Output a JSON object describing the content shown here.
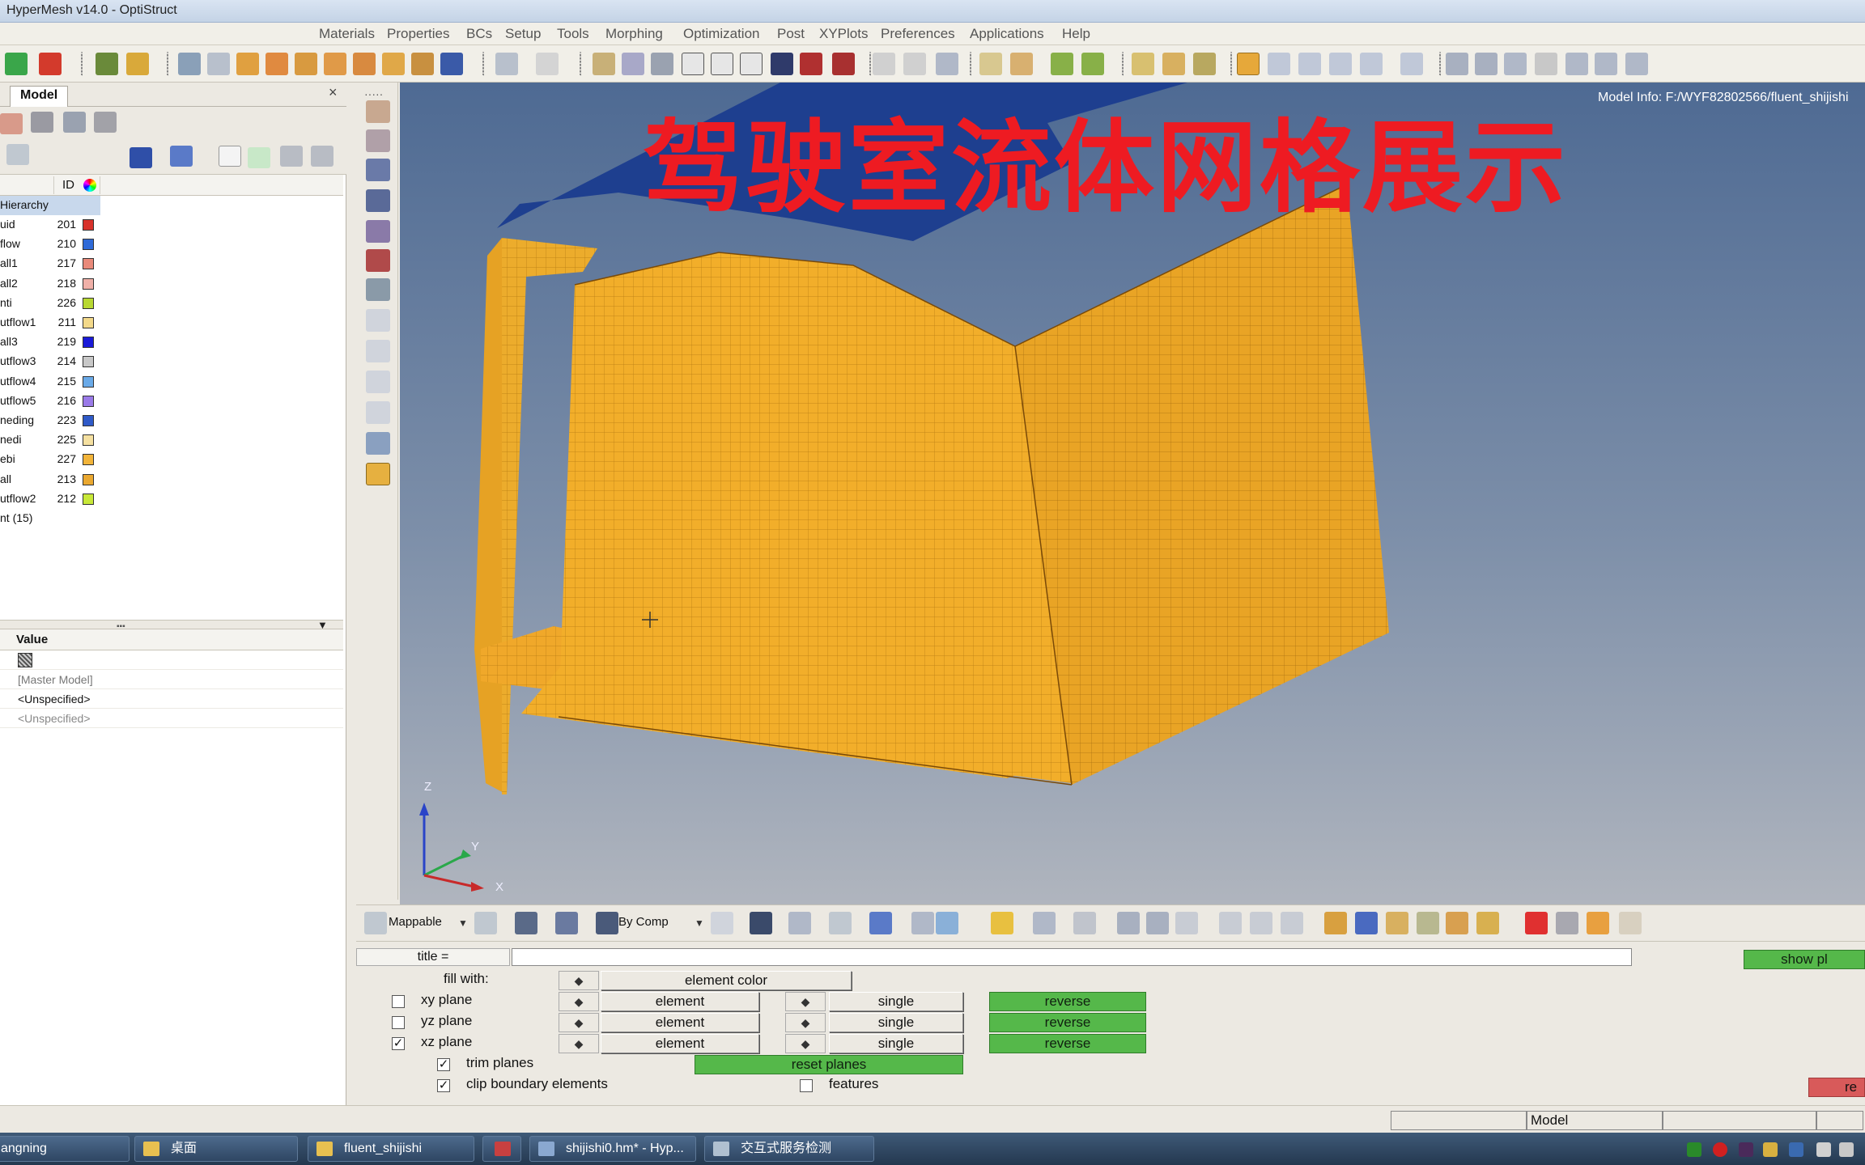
{
  "window": {
    "title": "HyperMesh v14.0 - OptiStruct"
  },
  "menu": [
    "Materials",
    "Properties",
    "BCs",
    "Setup",
    "Tools",
    "Morphing",
    "Optimization",
    "Post",
    "XYPlots",
    "Preferences",
    "Applications",
    "Help"
  ],
  "left_panel": {
    "tab_label": "Model",
    "close_glyph": "×",
    "id_column": "ID",
    "hierarchy_label": "Hierarchy",
    "components": [
      {
        "name": "uid",
        "id": "201",
        "color": "#d8322b"
      },
      {
        "name": "flow",
        "id": "210",
        "color": "#2f6ad8"
      },
      {
        "name": "all1",
        "id": "217",
        "color": "#e98a7a"
      },
      {
        "name": "all2",
        "id": "218",
        "color": "#f0b0a8"
      },
      {
        "name": "nti",
        "id": "226",
        "color": "#b8d832"
      },
      {
        "name": "utflow1",
        "id": "211",
        "color": "#f3d98a"
      },
      {
        "name": "all3",
        "id": "219",
        "color": "#1a1ad8"
      },
      {
        "name": "utflow3",
        "id": "214",
        "color": "#c8c8c8"
      },
      {
        "name": "utflow4",
        "id": "215",
        "color": "#6aaae8"
      },
      {
        "name": "utflow5",
        "id": "216",
        "color": "#9a7ae8"
      },
      {
        "name": "neding",
        "id": "223",
        "color": "#2f5ac8"
      },
      {
        "name": "nedi",
        "id": "225",
        "color": "#f5e0a0"
      },
      {
        "name": "ebi",
        "id": "227",
        "color": "#f2b43a"
      },
      {
        "name": "all",
        "id": "213",
        "color": "#eaa830"
      },
      {
        "name": "utflow2",
        "id": "212",
        "color": "#c8e838"
      }
    ],
    "count_label": "nt (15)",
    "value_header": "Value",
    "values": [
      "[Master Model]",
      "<Unspecified>",
      "<Unspecified>"
    ]
  },
  "viewport": {
    "banner": "驾驶室流体网格展示",
    "model_info": "Model Info: F:/WYF82802566/fluent_shijishi",
    "mesh_color": "#f2ae2a",
    "top_color": "#1e3f8f",
    "triad": {
      "z": "Z",
      "y": "Y",
      "x": "X"
    }
  },
  "bottom_toolbar": {
    "mappable": "Mappable",
    "by_comp": "By Comp"
  },
  "panel": {
    "title_label": "title =",
    "show_plane_label": "show pl",
    "fill_with_label": "fill with:",
    "fill_with_value": "element color",
    "spin_glyph": "◆",
    "planes": [
      {
        "label": "xy plane",
        "checked": false,
        "mode": "element",
        "count": "single",
        "reverse": "reverse"
      },
      {
        "label": "yz plane",
        "checked": false,
        "mode": "element",
        "count": "single",
        "reverse": "reverse"
      },
      {
        "label": "xz plane",
        "checked": true,
        "mode": "element",
        "count": "single",
        "reverse": "reverse"
      }
    ],
    "trim_planes": {
      "label": "trim planes",
      "checked": true
    },
    "clip_boundary": {
      "label": "clip boundary elements",
      "checked": true
    },
    "reset_planes": "reset planes",
    "features": {
      "label": "features",
      "checked": false
    },
    "return_label": "re"
  },
  "status": {
    "model": "Model"
  },
  "taskbar": [
    {
      "label": "angning"
    },
    {
      "label": "桌面"
    },
    {
      "label": "fluent_shijishi"
    },
    {
      "label": ""
    },
    {
      "label": "shijishi0.hm* - Hyp..."
    },
    {
      "label": "交互式服务检测"
    }
  ]
}
